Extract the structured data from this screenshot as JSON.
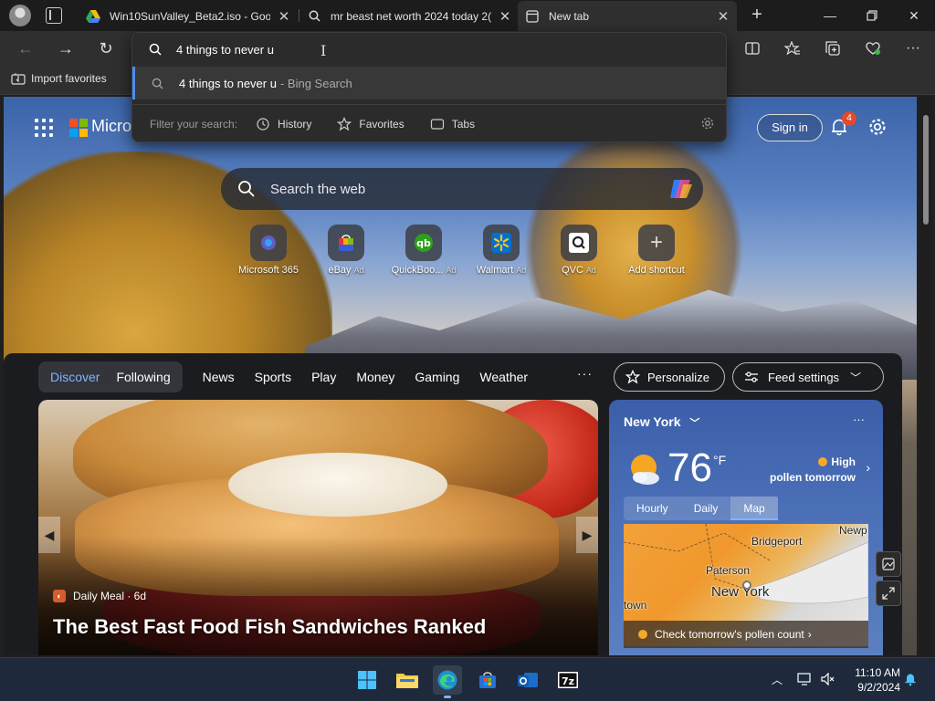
{
  "tabs": [
    {
      "title": "Win10SunValley_Beta2.iso - Goog",
      "icon": "google-drive-icon"
    },
    {
      "title": "mr beast net worth 2024 today 2(",
      "icon": "search-icon"
    },
    {
      "title": "New tab",
      "icon": "new-tab-icon",
      "active": true
    }
  ],
  "favorites_bar": {
    "import_label": "Import favorites"
  },
  "omnibox": {
    "query": "4 things to never u",
    "suggestion": {
      "text": "4 things to never u",
      "source": "- Bing Search"
    },
    "filter_label": "Filter your search:",
    "filters": [
      "History",
      "Favorites",
      "Tabs"
    ]
  },
  "header": {
    "brand": "Micro",
    "signin": "Sign in",
    "notification_count": "4"
  },
  "search": {
    "placeholder": "Search the web"
  },
  "quick_links": [
    {
      "name": "Microsoft 365",
      "ad": ""
    },
    {
      "name": "eBay",
      "ad": "Ad"
    },
    {
      "name": "QuickBoo...",
      "ad": "Ad"
    },
    {
      "name": "Walmart",
      "ad": "Ad"
    },
    {
      "name": "QVC",
      "ad": "Ad"
    },
    {
      "name": "Add shortcut",
      "ad": ""
    }
  ],
  "feed": {
    "pills": [
      "Discover",
      "Following"
    ],
    "nav": [
      "News",
      "Sports",
      "Play",
      "Money",
      "Gaming",
      "Weather"
    ],
    "more": "···",
    "personalize": "Personalize",
    "feed_settings": "Feed settings"
  },
  "hero": {
    "provider": "Daily Meal · 6d",
    "headline": "The Best Fast Food Fish Sandwiches Ranked"
  },
  "weather": {
    "city": "New York",
    "temp": "76",
    "unit": "°F",
    "pollen_level": "High",
    "pollen_label": "pollen tomorrow",
    "tabs": [
      "Hourly",
      "Daily",
      "Map"
    ],
    "map_labels": [
      "Bridgeport",
      "Paterson",
      "New York",
      "town",
      "Newp"
    ],
    "check_link": "Check tomorrow's pollen count"
  },
  "taskbar": {
    "time": "11:10 AM",
    "date": "9/2/2024"
  }
}
